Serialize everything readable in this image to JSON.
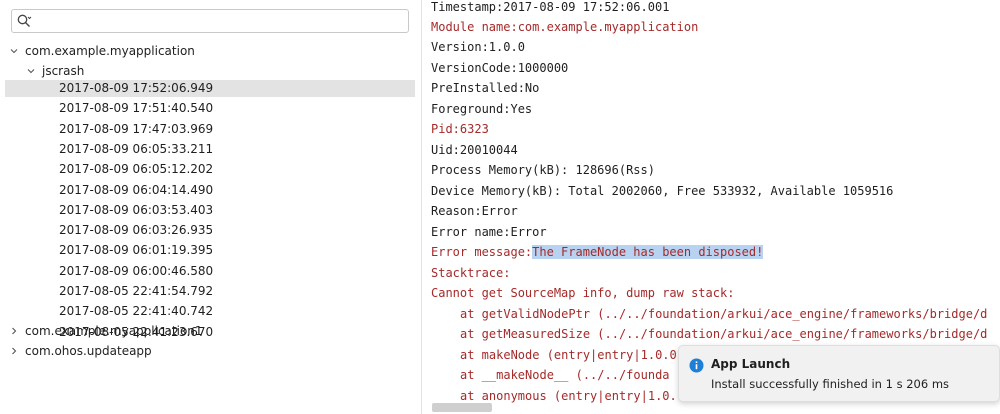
{
  "search": {
    "placeholder": "",
    "value": ""
  },
  "tree": {
    "app1": "com.example.myapplication",
    "group": "jscrash",
    "entries": [
      "2017-08-09 17:52:06.949",
      "2017-08-09 17:51:40.540",
      "2017-08-09 17:47:03.969",
      "2017-08-09 06:05:33.211",
      "2017-08-09 06:05:12.202",
      "2017-08-09 06:04:14.490",
      "2017-08-09 06:03:53.403",
      "2017-08-09 06:03:26.935",
      "2017-08-09 06:01:19.395",
      "2017-08-09 06:00:46.580",
      "2017-08-05 22:41:54.792",
      "2017-08-05 22:41:40.742",
      "2017-08-05 22:41:23.670"
    ],
    "app2": "com.example.myapplication1",
    "app3": "com.ohos.updateapp"
  },
  "log": {
    "timestamp": "Timestamp:2017-08-09 17:52:06.001",
    "module": "Module name:com.example.myapplication",
    "version": "Version:1.0.0",
    "version_code": "VersionCode:1000000",
    "preinstalled": "PreInstalled:No",
    "foreground": "Foreground:Yes",
    "pid": "Pid:6323",
    "uid": "Uid:20010044",
    "process_memory": "Process Memory(kB): 128696(Rss)",
    "device_memory": "Device Memory(kB): Total 2002060, Free 533932, Available 1059516",
    "reason": "Reason:Error",
    "error_name": "Error name:Error",
    "error_message_label": "Error message:",
    "error_message_value": "The FrameNode has been disposed!",
    "stacktrace": "Stacktrace:",
    "sourcemap": "Cannot get SourceMap info, dump raw stack:",
    "frame1": "at getValidNodePtr (../../foundation/arkui/ace_engine/frameworks/bridge/d",
    "frame2": "at getMeasuredSize (../../foundation/arkui/ace_engine/frameworks/bridge/d",
    "frame3": "at makeNode (entry|entry|1.0.0",
    "frame4": "at __makeNode__ (../../founda",
    "frame5": "at anonymous (entry|entry|1.0."
  },
  "toast": {
    "title": "App Launch",
    "message": "Install successfully finished in 1 s 206 ms"
  },
  "colors": {
    "log_red": "#a52a2a",
    "highlight": "#b7d3f1",
    "selection": "#e3e3e3",
    "info_blue": "#1f7fd6"
  }
}
